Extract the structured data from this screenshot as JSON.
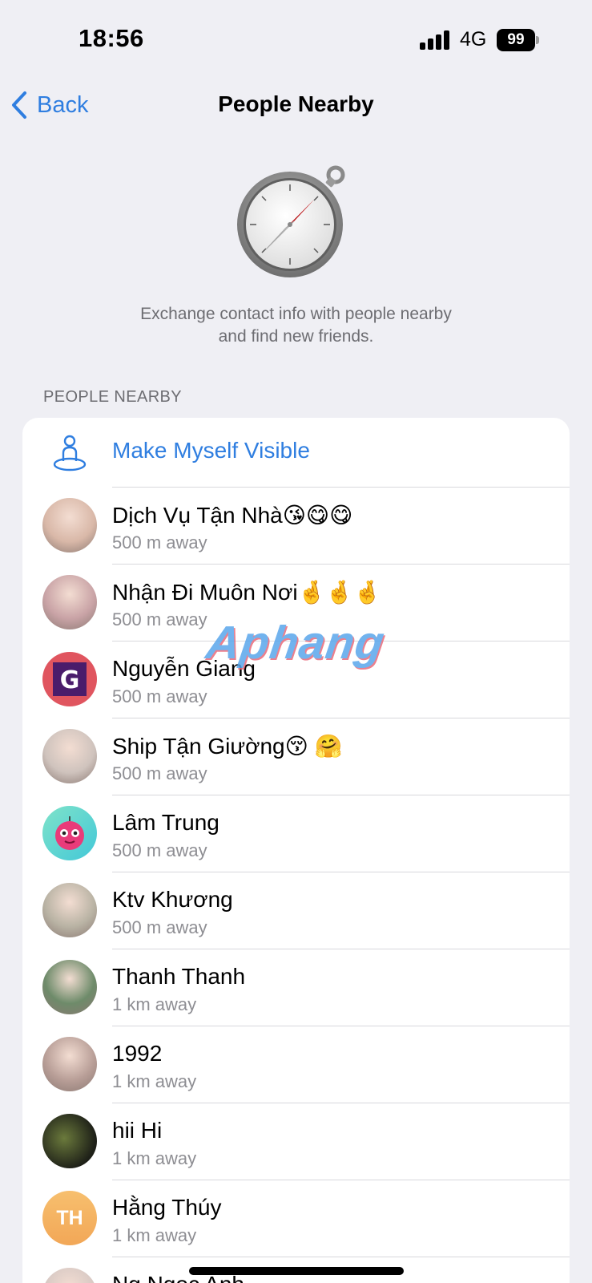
{
  "status_bar": {
    "time": "18:56",
    "network": "4G",
    "battery": "99"
  },
  "nav": {
    "back_label": "Back",
    "title": "People Nearby"
  },
  "intro": {
    "line1": "Exchange contact info with people nearby",
    "line2": "and find new friends."
  },
  "section_header": "PEOPLE NEARBY",
  "make_visible_label": "Make Myself Visible",
  "people": [
    {
      "name": "Dịch Vụ Tận Nhà😘😋😋",
      "distance": "500 m away",
      "avatar": "photo-portrait",
      "initials": "",
      "color": "#d9b8a8"
    },
    {
      "name": "Nhận Đi Muôn Nơi🤞🤞🤞",
      "distance": "500 m away",
      "avatar": "photo-portrait",
      "initials": "",
      "color": "#c9a3a6"
    },
    {
      "name": "Nguyễn Giang",
      "distance": "500 m away",
      "avatar": "G-logo",
      "initials": "G",
      "color": "#e0555f"
    },
    {
      "name": "Ship Tận Giường😚 🤗",
      "distance": "500 m away",
      "avatar": "photo-portrait",
      "initials": "",
      "color": "#cfc3bd"
    },
    {
      "name": "Lâm Trung",
      "distance": "500 m away",
      "avatar": "cartoon-face",
      "initials": "",
      "color": "#52d6c6"
    },
    {
      "name": "Ktv Khương",
      "distance": "500 m away",
      "avatar": "photo-toy",
      "initials": "",
      "color": "#b9b3a4"
    },
    {
      "name": "Thanh Thanh",
      "distance": "1 km away",
      "avatar": "photo-portrait",
      "initials": "",
      "color": "#6e8b6a"
    },
    {
      "name": "1992",
      "distance": "1 km away",
      "avatar": "photo-portrait",
      "initials": "",
      "color": "#b89e97"
    },
    {
      "name": "hii Hi",
      "distance": "1 km away",
      "avatar": "photo-dark",
      "initials": "",
      "color": "#2b2e25"
    },
    {
      "name": "Hằng Thúy",
      "distance": "1 km away",
      "avatar": "initials",
      "initials": "TH",
      "color": "#f2a757"
    },
    {
      "name": "Ng Ngọc Anh",
      "distance": "",
      "avatar": "photo-portrait",
      "initials": "",
      "color": "#d8c9c4"
    }
  ],
  "watermark": "Aphang",
  "colors": {
    "accent": "#2f7ee0",
    "background": "#efeff4",
    "secondary_text": "#8e8e93"
  }
}
